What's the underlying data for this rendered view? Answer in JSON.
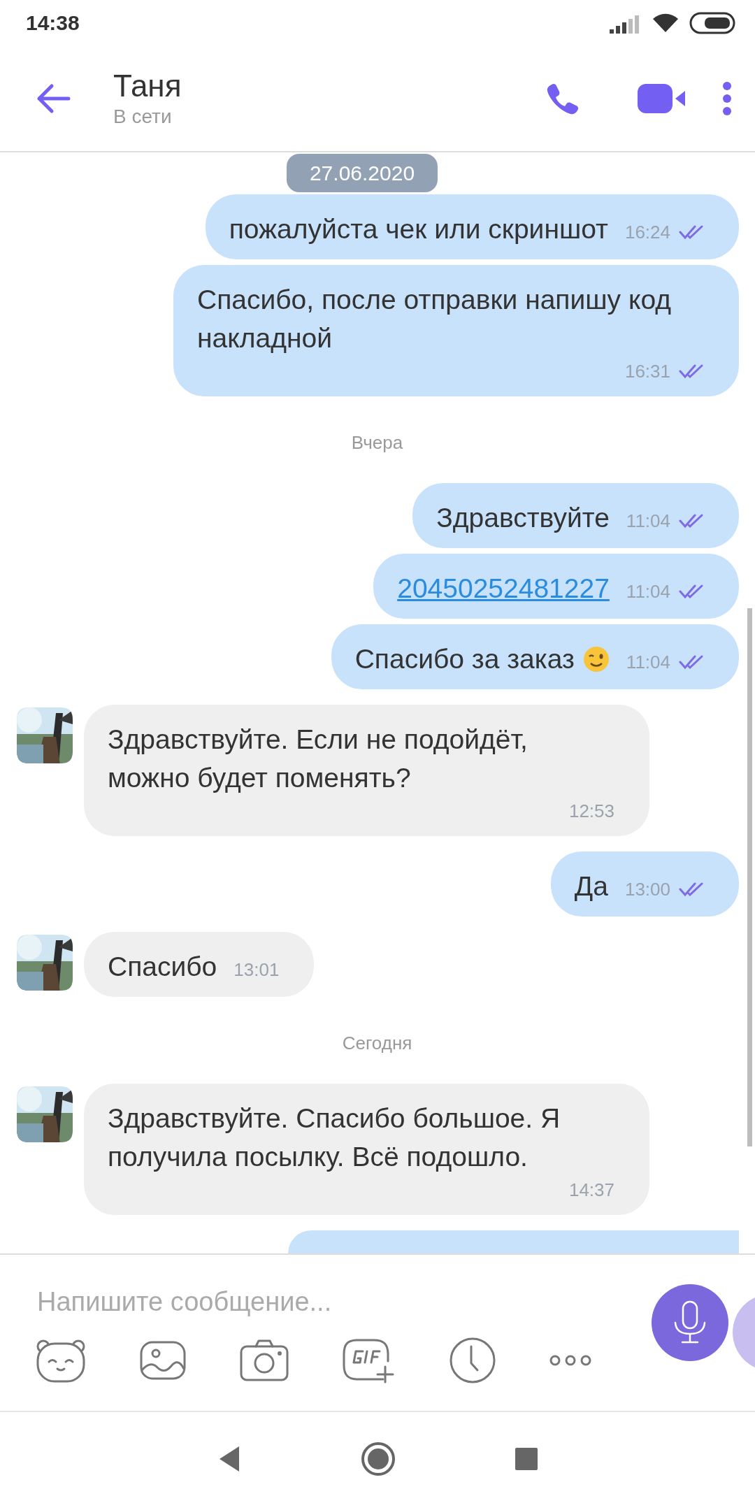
{
  "status_bar": {
    "time": "14:38"
  },
  "header": {
    "name": "Таня",
    "status": "В сети"
  },
  "date_pill": "27.06.2020",
  "messages": [
    {
      "kind": "outgoing",
      "text": "пожалуйста чек или скриншот",
      "time": "16:24",
      "read": true
    },
    {
      "kind": "outgoing",
      "text": "Спасибо, после отправки напишу код накладной",
      "time": "16:31",
      "read": true
    },
    {
      "kind": "date",
      "text": "Вчера"
    },
    {
      "kind": "outgoing",
      "text": "Здравствуйте",
      "time": "11:04",
      "read": true
    },
    {
      "kind": "outgoing",
      "text": "20450252481227",
      "time": "11:04",
      "read": true,
      "link": true
    },
    {
      "kind": "outgoing",
      "text": "Спасибо за заказ",
      "time": "11:04",
      "read": true,
      "wink": true
    },
    {
      "kind": "incoming",
      "text": "Здравствуйте. Если не подойдёт, можно будет поменять?",
      "time": "12:53"
    },
    {
      "kind": "outgoing",
      "text": "Да",
      "time": "13:00",
      "read": true
    },
    {
      "kind": "incoming",
      "text": "Спасибо",
      "time": "13:01"
    },
    {
      "kind": "date",
      "text": "Сегодня"
    },
    {
      "kind": "incoming",
      "text": "Здравствуйте. Спасибо большое. Я получила посылку. Всё подошло.",
      "time": "14:37"
    },
    {
      "kind": "peek"
    }
  ],
  "composer": {
    "placeholder": "Напишите сообщение..."
  }
}
